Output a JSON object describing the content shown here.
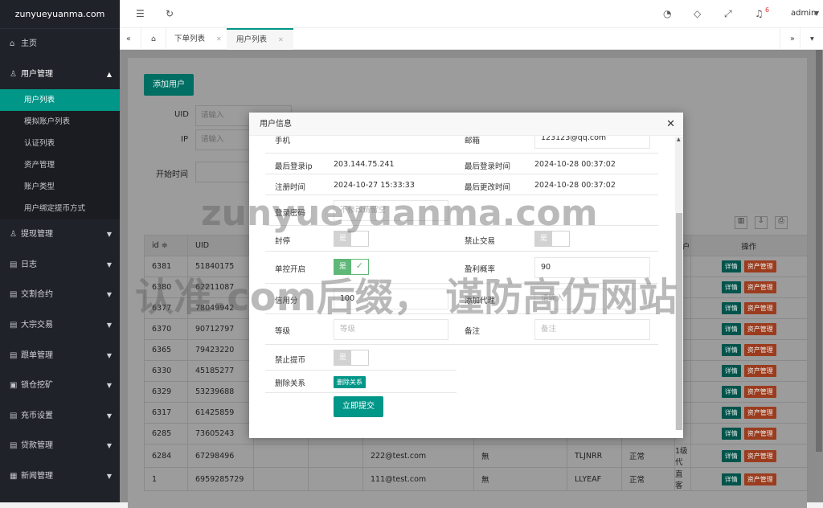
{
  "brand": "zunyueyuanma.com",
  "sidebar": {
    "home": "主页",
    "user_mgmt": "用户管理",
    "sub": [
      "用户列表",
      "模拟账户列表",
      "认证列表",
      "资产管理",
      "账户类型",
      "用户绑定提币方式"
    ],
    "items": [
      "提现管理",
      "日志",
      "交割合约",
      "大宗交易",
      "跟单管理",
      "锁仓挖矿",
      "充币设置",
      "贷款管理",
      "新闻管理"
    ]
  },
  "topbar": {
    "user": "admin",
    "badge": "6"
  },
  "tabs": [
    "下单列表",
    "用户列表"
  ],
  "page": {
    "add_user": "添加用户",
    "uid_label": "UID",
    "ip_label": "IP",
    "start_label": "开始时间",
    "placeholder": "请输入"
  },
  "table": {
    "headers": [
      "id ≑",
      "UID",
      "户",
      "操作"
    ],
    "rows": [
      [
        "6381",
        "51840175",
        "",
        "",
        "",
        "",
        "",
        "客"
      ],
      [
        "6380",
        "62211087",
        "",
        "",
        "",
        "",
        "",
        "客"
      ],
      [
        "6377",
        "78049942",
        "",
        "",
        "",
        "",
        "",
        "客"
      ],
      [
        "6370",
        "90712797",
        "",
        "",
        "",
        "",
        "",
        "客"
      ],
      [
        "6365",
        "79423220",
        "",
        "",
        "",
        "",
        "",
        "客"
      ],
      [
        "6330",
        "45185277",
        "",
        "",
        "",
        "",
        "",
        "客"
      ],
      [
        "6329",
        "53239688",
        "",
        "",
        "",
        "",
        "",
        "客"
      ],
      [
        "6317",
        "61425859",
        "",
        "",
        "",
        "",
        "",
        "客"
      ],
      [
        "6285",
        "73605243",
        "",
        "",
        "",
        "",
        "",
        "客"
      ],
      [
        "6284",
        "67298496",
        "222@test.com",
        "無",
        "TLJNRR",
        "正常",
        "1级代"
      ],
      [
        "1",
        "6959285729",
        "111@test.com",
        "無",
        "LLYEAF",
        "正常",
        "直客"
      ]
    ],
    "btn_detail": "详情",
    "btn_asset": "资产管理"
  },
  "modal": {
    "title": "用户信息",
    "phone_label": "手机",
    "email_label": "邮箱",
    "email": "123123@qq.com",
    "last_ip_label": "最后登录ip",
    "last_ip": "203.144.75.241",
    "last_login_label": "最后登录时间",
    "last_login": "2024-10-28 00:37:02",
    "reg_label": "注册时间",
    "reg": "2024-10-27 15:33:33",
    "update_label": "最后更改时间",
    "update": "2024-10-28 00:37:02",
    "pwd_label": "登录密码",
    "pwd_ph": "不修改请留空",
    "ban_label": "封停",
    "trade_ban_label": "禁止交易",
    "switch_yes": "是",
    "control_label": "单控开启",
    "profit_label": "盈利概率",
    "profit": "90",
    "credit_label": "信用分",
    "credit": "100",
    "agent_label": "添加代理",
    "agent_ph": "请输入",
    "level_label": "等级",
    "level_ph": "等级",
    "note_label": "备注",
    "note_ph": "备注",
    "withdraw_ban_label": "禁止提币",
    "del_rel_label": "删除关系",
    "del_rel_btn": "删除关系",
    "submit": "立即提交"
  },
  "watermark": {
    "line1": "zunyueyuanma.com",
    "line2": "认准.com后缀， 谨防高仿网站"
  }
}
